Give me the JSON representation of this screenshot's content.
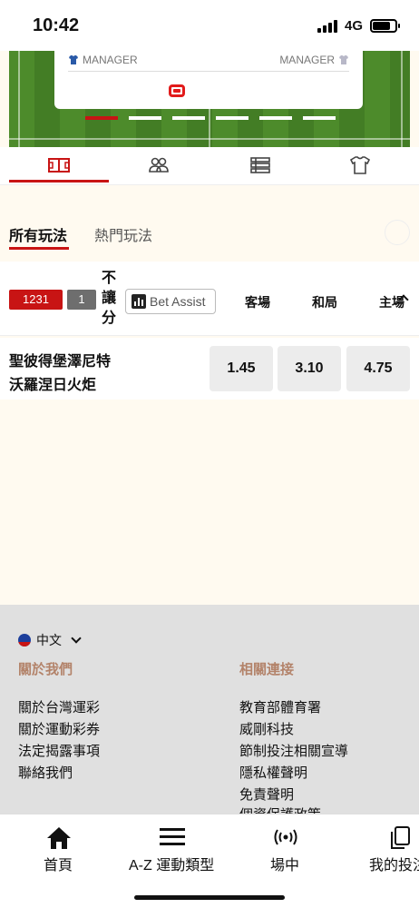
{
  "status": {
    "time": "10:42",
    "network": "4G"
  },
  "match_header": {
    "left_manager": "MANAGER",
    "right_manager": "MANAGER"
  },
  "tabs": [
    "field-icon",
    "people-icon",
    "list-icon",
    "shirt-icon"
  ],
  "market_tabs": {
    "active": "所有玩法",
    "inactive": "熱門玩法"
  },
  "odds_header": {
    "match_no": "1231",
    "handicap_value": "1",
    "handicap_label": "不讓分",
    "bet_assist": "Bet Assist",
    "columns": [
      "客場",
      "和局",
      "主場"
    ]
  },
  "match": {
    "away_team": "聖彼得堡澤尼特",
    "home_team": "沃羅涅日火炬",
    "odds": [
      "1.45",
      "3.10",
      "4.75"
    ]
  },
  "footer": {
    "language": "中文",
    "about_title": "關於我們",
    "about_links": [
      "關於台灣運彩",
      "關於運動彩券",
      "法定揭露事項",
      "聯絡我們"
    ],
    "related_title": "相關連接",
    "related_links": [
      "教育部體育署",
      "威剛科技",
      "節制投注相關宣導",
      "隱私權聲明",
      "免責聲明",
      "個資保護政策"
    ]
  },
  "bottom_nav": [
    "首頁",
    "A-Z 運動類型",
    "場中",
    "我的投注"
  ],
  "colors": {
    "accent": "#c81414",
    "pitch": "#4d8b2b",
    "footer_title": "#b3836a"
  }
}
